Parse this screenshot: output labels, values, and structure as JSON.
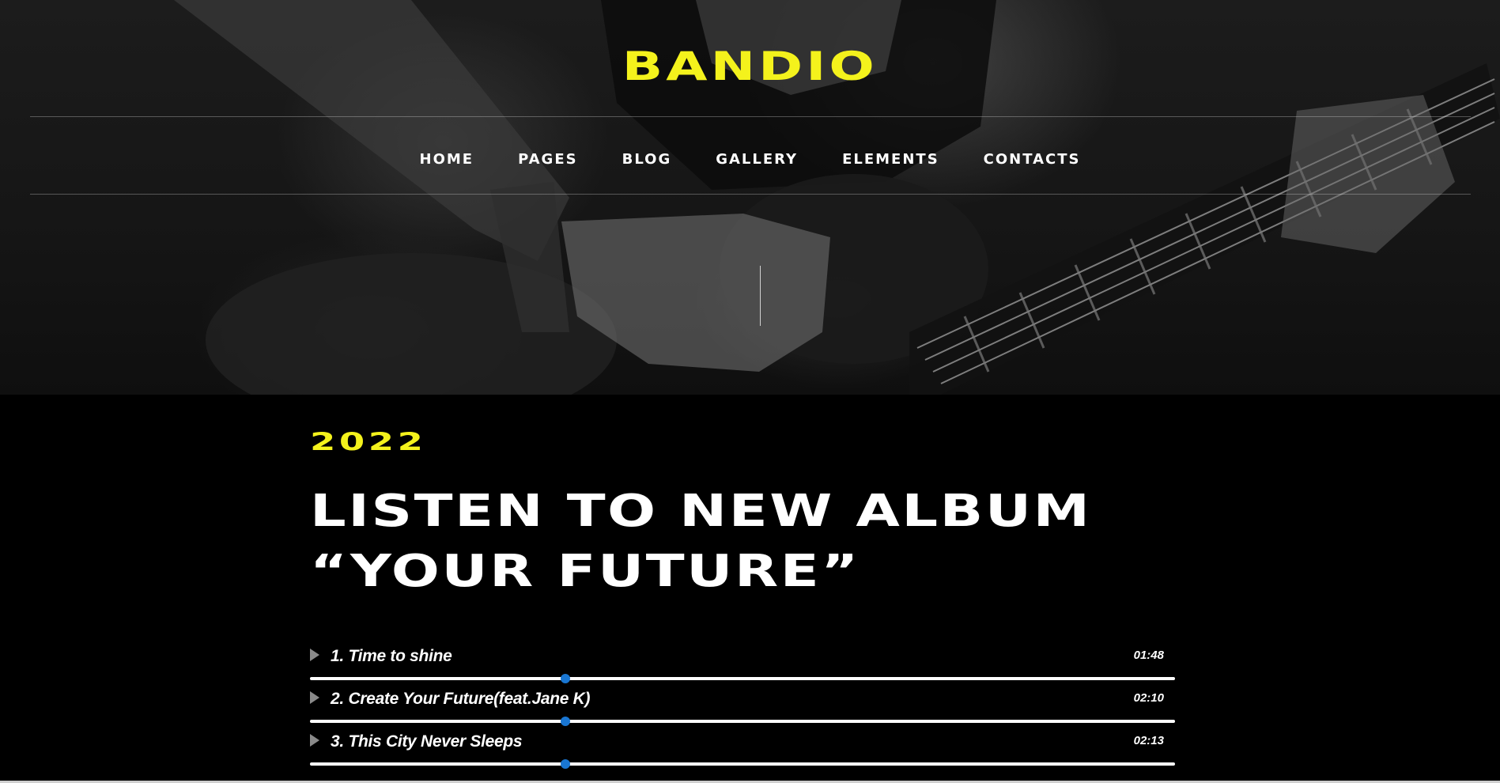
{
  "brand": {
    "logo_text": "BANDIO",
    "accent_color": "#f4f21c"
  },
  "nav": {
    "items": [
      {
        "label": "HOME"
      },
      {
        "label": "PAGES"
      },
      {
        "label": "BLOG"
      },
      {
        "label": "GALLERY"
      },
      {
        "label": "ELEMENTS"
      },
      {
        "label": "CONTACTS"
      }
    ]
  },
  "hero": {
    "background": "guitarist-photo-grayscale"
  },
  "album": {
    "year": "2022",
    "headline_line1": "LISTEN TO NEW ALBUM",
    "headline_line2": "“YOUR FUTURE”"
  },
  "tracks": [
    {
      "title": "1. Time to shine",
      "duration": "01:48",
      "progress": 0.295
    },
    {
      "title": "2. Create Your Future(feat.Jane K)",
      "duration": "02:10",
      "progress": 0.295
    },
    {
      "title": "3. This City Never Sleeps",
      "duration": "02:13",
      "progress": 0.295
    }
  ],
  "player": {
    "progress_color": "#1976d2",
    "play_icon": "play-icon"
  }
}
